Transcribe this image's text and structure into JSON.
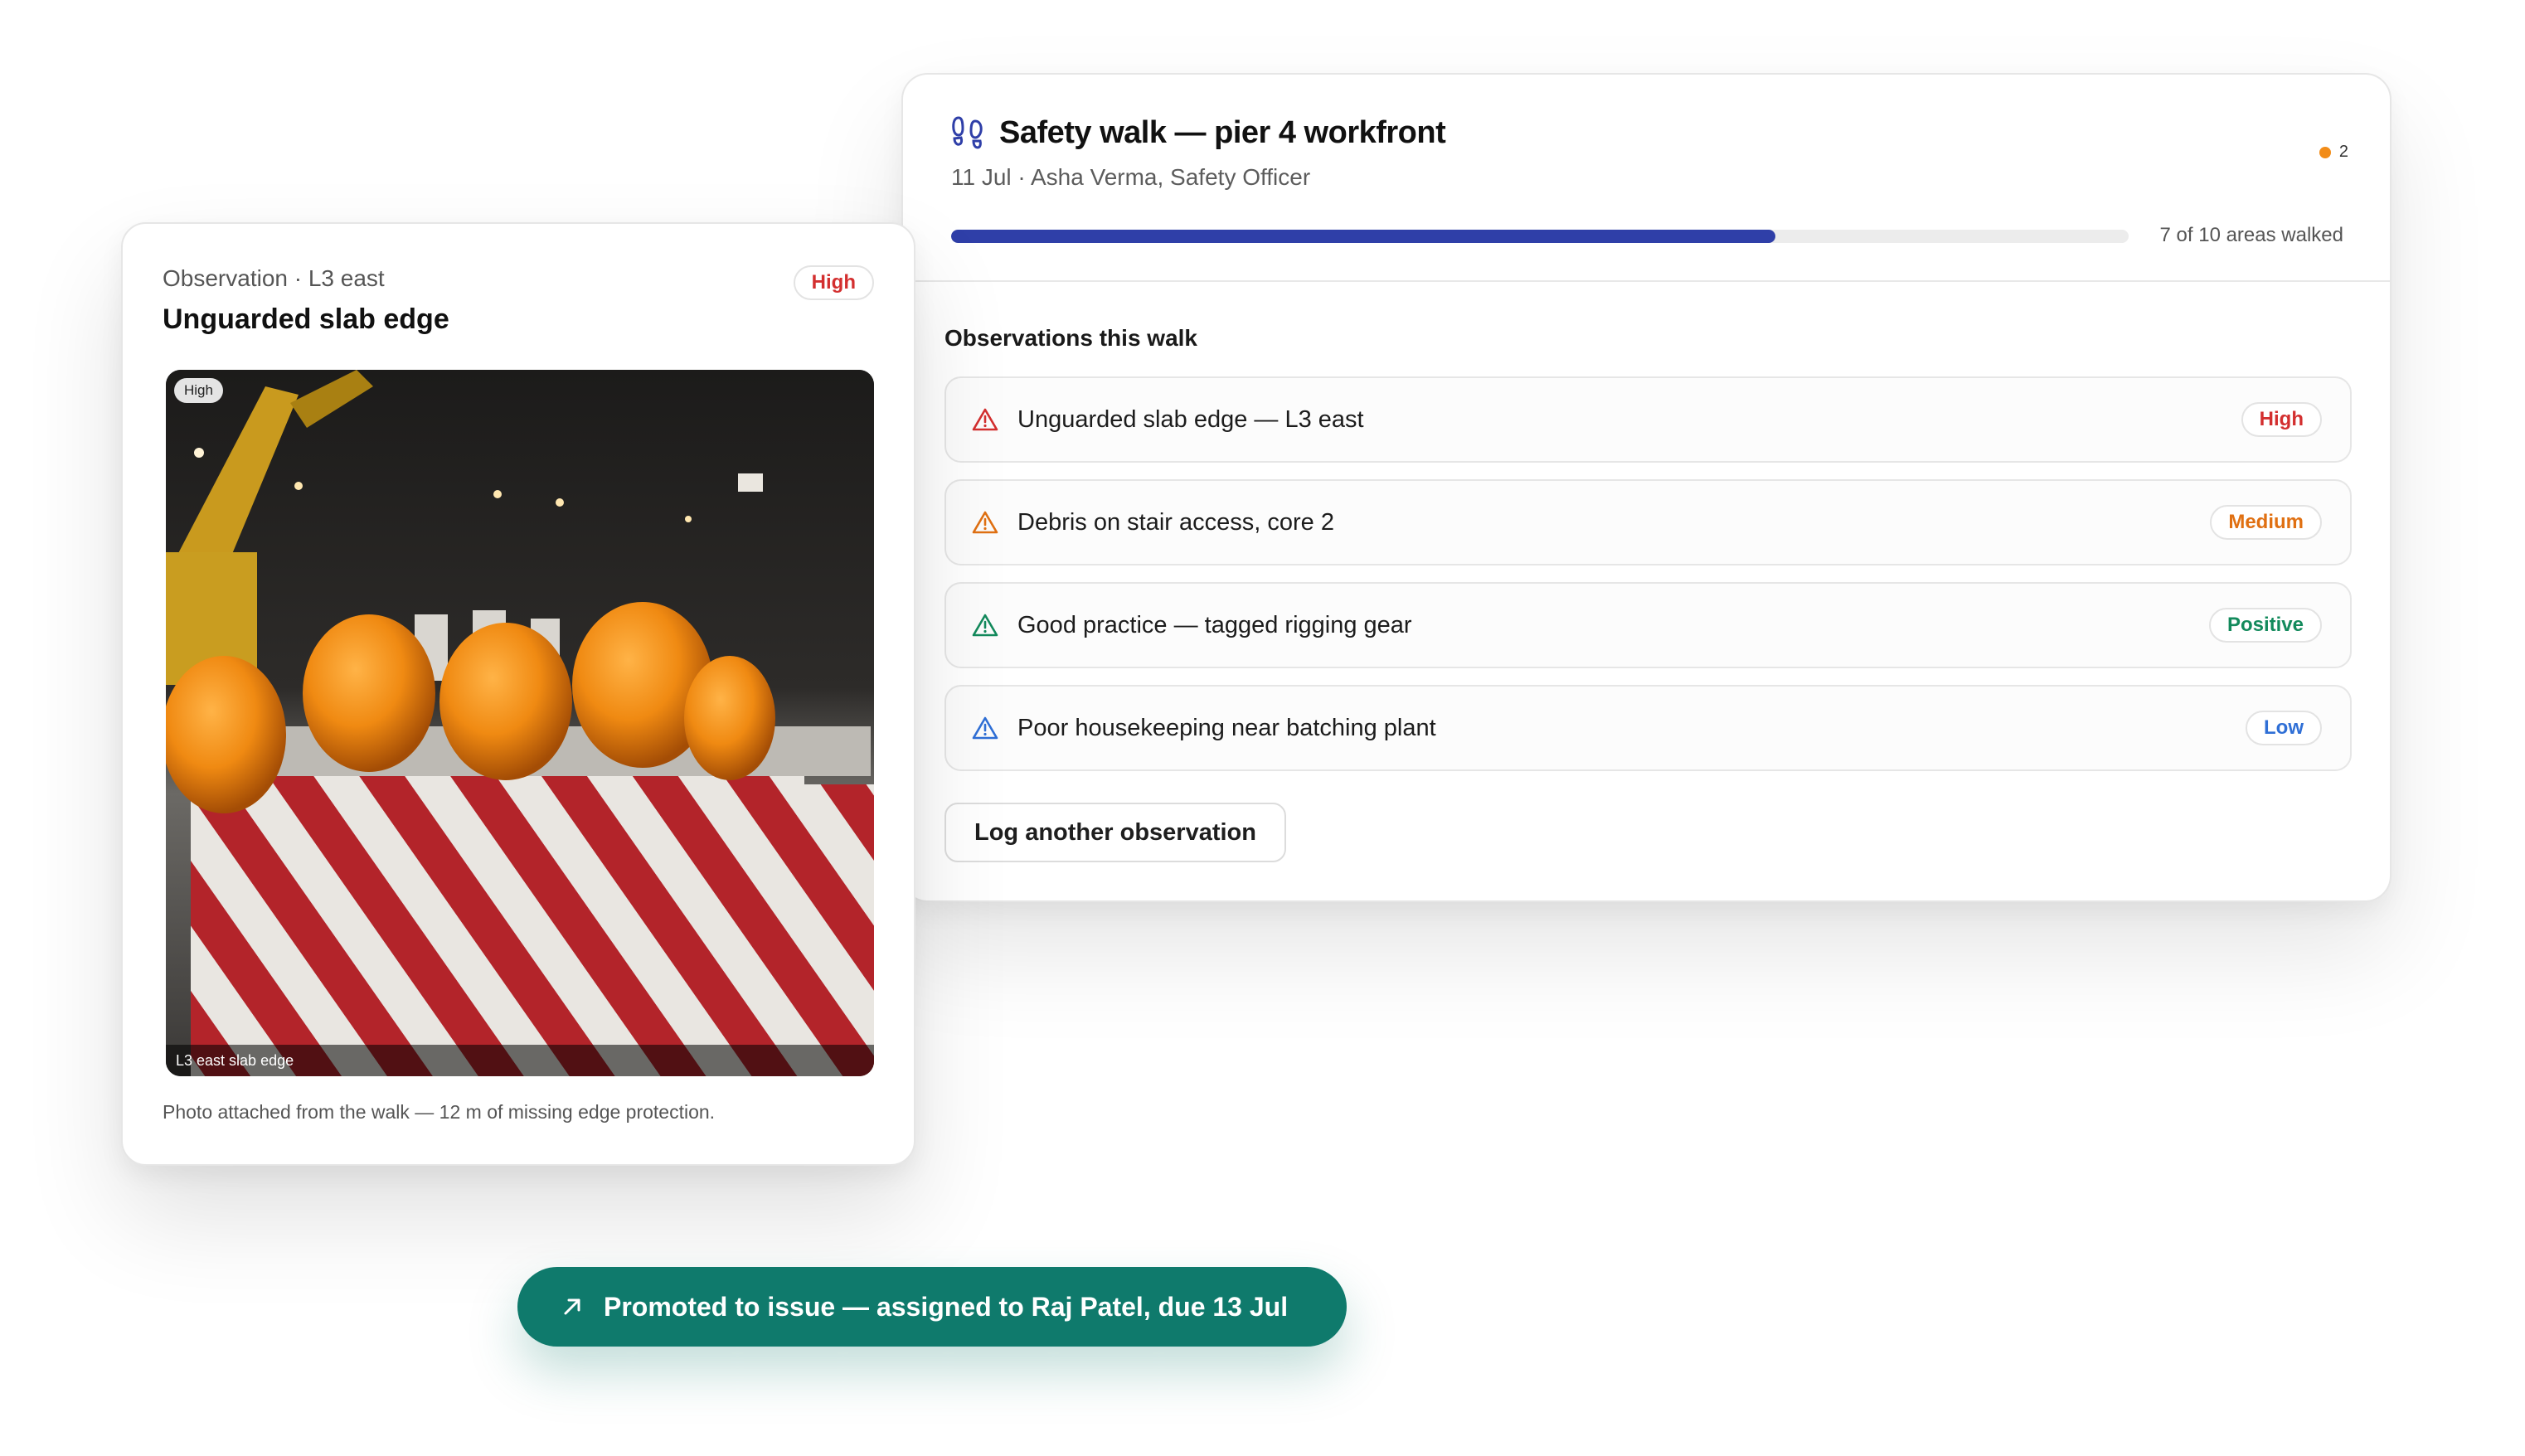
{
  "walk": {
    "title": "Safety walk — pier 4 workfront",
    "subtitle": "11 Jul · Asha Verma, Safety Officer",
    "notification_count": "2",
    "progress_fraction": 0.7,
    "progress_label": "7 of 10 areas walked",
    "observations_heading": "Observations this walk",
    "observations": [
      {
        "text": "Unguarded slab edge — L3 east",
        "severity": "High",
        "color": "#d32f2f",
        "icon": "warning-triangle-icon"
      },
      {
        "text": "Debris on stair access, core 2",
        "severity": "Medium",
        "color": "#e07012",
        "icon": "warning-triangle-icon"
      },
      {
        "text": "Good practice — tagged rigging gear",
        "severity": "Positive",
        "color": "#138a5c",
        "icon": "warning-triangle-icon"
      },
      {
        "text": "Poor housekeeping near batching plant",
        "severity": "Low",
        "color": "#2f6fd6",
        "icon": "warning-triangle-icon"
      }
    ],
    "log_button": "Log another observation"
  },
  "observation_card": {
    "kicker": "Observation · L3 east",
    "title": "Unguarded slab edge",
    "badge": "High",
    "photo_tag": "High",
    "photo_caption": "L3 east slab edge",
    "note": "Photo attached from the walk — 12 m of missing edge protection."
  },
  "promoted": {
    "label": "Promoted to issue — assigned to Raj Patel, due 13 Jul"
  },
  "colors": {
    "accent": "#2f3fa8",
    "promoted": "#0f7a6c",
    "notification": "#f28c18"
  }
}
